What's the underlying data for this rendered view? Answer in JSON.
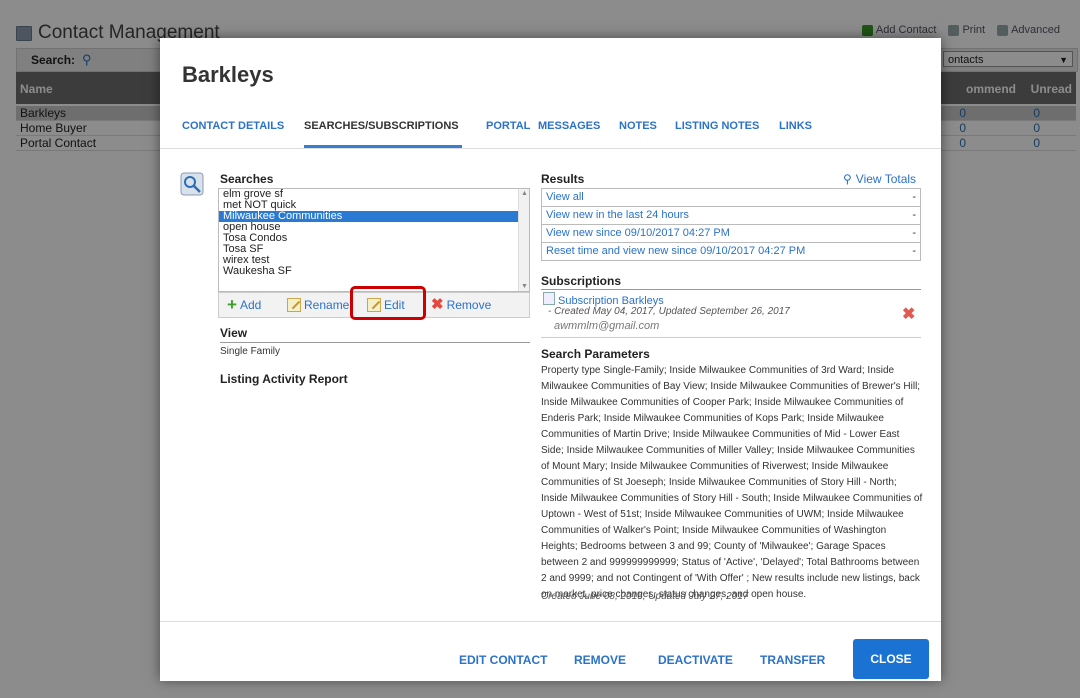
{
  "background": {
    "title": "Contact Management",
    "toolbar": [
      "Add Contact",
      "Print",
      "Advanced"
    ],
    "search_label": "Search:",
    "filter_value": "ontacts",
    "columns": {
      "name": "Name",
      "comment": "ommend",
      "unread": "Unread"
    },
    "rows": [
      {
        "name": "Barkleys",
        "comment": "0",
        "unread": "0"
      },
      {
        "name": "Home Buyer",
        "comment": "0",
        "unread": "0"
      },
      {
        "name": "Portal Contact",
        "comment": "0",
        "unread": "0"
      }
    ]
  },
  "modal": {
    "title": "Barkleys",
    "tabs": [
      "CONTACT DETAILS",
      "SEARCHES/SUBSCRIPTIONS",
      "PORTAL",
      "MESSAGES",
      "NOTES",
      "LISTING NOTES",
      "LINKS"
    ],
    "active_tab": "SEARCHES/SUBSCRIPTIONS",
    "searches": {
      "heading": "Searches",
      "items": [
        "elm grove sf",
        "met NOT quick",
        "Milwaukee Communities",
        "open house",
        "Tosa Condos",
        "Tosa SF",
        "wirex test",
        "Waukesha SF"
      ],
      "selected": "Milwaukee Communities",
      "actions": {
        "add": "Add",
        "rename": "Rename",
        "edit": "Edit",
        "remove": "Remove"
      }
    },
    "view": {
      "heading": "View",
      "value": "Single Family"
    },
    "listing_activity_heading": "Listing Activity Report",
    "results": {
      "heading": "Results",
      "view_totals": "View Totals",
      "rows": [
        "View all",
        "View new in the last 24 hours",
        "View new since 09/10/2017 04:27 PM",
        "Reset time and view new since 09/10/2017 04:27 PM"
      ]
    },
    "subscriptions": {
      "heading": "Subscriptions",
      "item": "Subscription Barkleys",
      "meta": "- Created May 04, 2017, Updated September 26, 2017",
      "email": "awmmlm@gmail.com"
    },
    "search_parameters": {
      "heading": "Search Parameters",
      "text": "Property type Single-Family; Inside Milwaukee Communities of 3rd Ward; Inside Milwaukee Communities of Bay View; Inside Milwaukee Communities of Brewer's Hill; Inside Milwaukee Communities of Cooper Park; Inside Milwaukee Communities of Enderis Park; Inside Milwaukee Communities of Kops Park; Inside Milwaukee Communities of Martin Drive; Inside Milwaukee Communities of Mid - Lower East Side; Inside Milwaukee Communities of Miller Valley; Inside Milwaukee Communities of Mount Mary; Inside Milwaukee Communities of Riverwest; Inside Milwaukee Communities of St Joeseph; Inside Milwaukee Communities of Story Hill - North; Inside Milwaukee Communities of Story Hill - South; Inside Milwaukee Communities of Uptown - West of 51st; Inside Milwaukee Communities of UWM; Inside Milwaukee Communities of Walker's Point; Inside Milwaukee Communities of Washington Heights; Bedrooms between 3 and 99; County of 'Milwaukee'; Garage Spaces between 2 and 999999999999; Status of 'Active', 'Delayed'; Total Bathrooms between 2 and 9999; and not Contingent of 'With Offer' ; New results include new listings, back on market, price changes, status changes, and open house.",
      "footer": "Created June 08, 2016, Updated July 27, 2017"
    },
    "footer_buttons": {
      "edit_contact": "EDIT CONTACT",
      "remove": "REMOVE",
      "deactivate": "DEACTIVATE",
      "transfer": "TRANSFER",
      "close": "CLOSE"
    }
  }
}
